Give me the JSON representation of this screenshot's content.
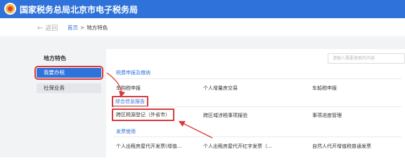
{
  "header": {
    "title": "国家税务总局北京市电子税务局"
  },
  "nav": {
    "back_label": "返回",
    "breadcrumb": {
      "home": "首页",
      "separator": ">",
      "current": "地方特色"
    }
  },
  "sidebar": {
    "title": "地方特色",
    "items": [
      {
        "label": "我要办税",
        "active": true
      },
      {
        "label": "社保业务",
        "active": false
      }
    ]
  },
  "search": {
    "placeholder": "请输入需要搜索的内容"
  },
  "sections": [
    {
      "title": "税费申报及缴纳",
      "items": [
        "车购税申报",
        "个人增量房交易",
        "车船税申报"
      ]
    },
    {
      "title": "综合信息报告",
      "items": [
        "跨区税源登记（外省市）",
        "跨区域涉税事项报验",
        "事项进度管理"
      ]
    },
    {
      "title": "发票使用",
      "items": [
        "个人出租房屋代开发票(增值...",
        "个人出租房屋代开红字发票（...",
        "自然人代开增值税普通发票"
      ]
    }
  ],
  "colors": {
    "brand": "#2f72d9",
    "highlight": "#d93a3a",
    "background": "#f2f3f5"
  }
}
